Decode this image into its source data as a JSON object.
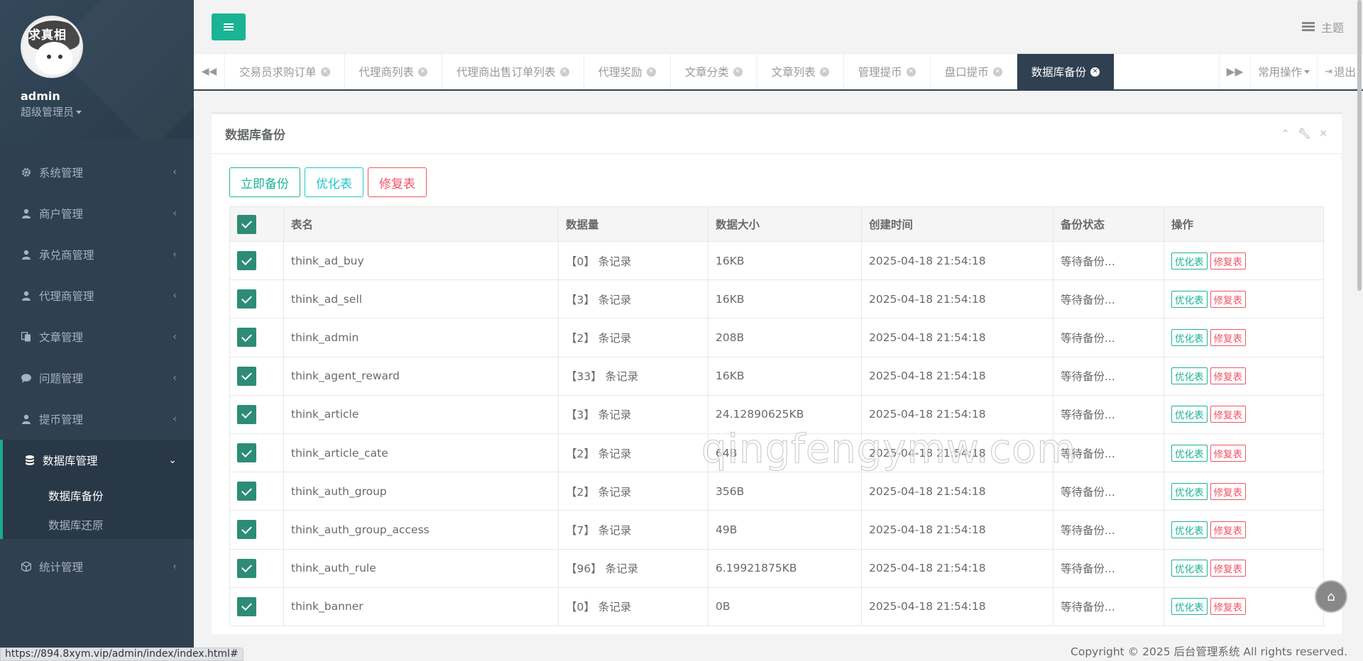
{
  "profile": {
    "logo_text": "求真相",
    "name": "admin",
    "role": "超级管理员"
  },
  "sidebar": {
    "items": [
      {
        "label": "系统管理",
        "icon": "gear-icon"
      },
      {
        "label": "商户管理",
        "icon": "user-icon"
      },
      {
        "label": "承兑商管理",
        "icon": "user-icon"
      },
      {
        "label": "代理商管理",
        "icon": "user-icon"
      },
      {
        "label": "文章管理",
        "icon": "copy-icon"
      },
      {
        "label": "问题管理",
        "icon": "comment-icon"
      },
      {
        "label": "提币管理",
        "icon": "user-icon"
      }
    ],
    "active_group": {
      "label": "数据库管理",
      "icon": "database-icon",
      "sub_items": [
        "数据库备份",
        "数据库还原"
      ]
    },
    "last_item": {
      "label": "统计管理",
      "icon": "cube-icon"
    }
  },
  "topbar": {
    "theme_label": "主题"
  },
  "tabs": {
    "items": [
      "交易员求购订单",
      "代理商列表",
      "代理商出售订单列表",
      "代理奖励",
      "文章分类",
      "文章列表",
      "管理提币",
      "盘口提币",
      "数据库备份"
    ],
    "active_index": 8,
    "common_ops": "常用操作",
    "logout": "退出"
  },
  "panel": {
    "title": "数据库备份",
    "buttons": {
      "backup": "立即备份",
      "optimize": "优化表",
      "repair": "修复表"
    }
  },
  "table": {
    "headers": [
      "表名",
      "数据量",
      "数据大小",
      "创建时间",
      "备份状态",
      "操作"
    ],
    "action_optimize": "优化表",
    "action_repair": "修复表",
    "rows": [
      {
        "name": "think_ad_buy",
        "count": "【0】 条记录",
        "size": "16KB",
        "time": "2025-04-18 21:54:18",
        "status": "等待备份..."
      },
      {
        "name": "think_ad_sell",
        "count": "【3】 条记录",
        "size": "16KB",
        "time": "2025-04-18 21:54:18",
        "status": "等待备份..."
      },
      {
        "name": "think_admin",
        "count": "【2】 条记录",
        "size": "208B",
        "time": "2025-04-18 21:54:18",
        "status": "等待备份..."
      },
      {
        "name": "think_agent_reward",
        "count": "【33】 条记录",
        "size": "16KB",
        "time": "2025-04-18 21:54:18",
        "status": "等待备份..."
      },
      {
        "name": "think_article",
        "count": "【3】 条记录",
        "size": "24.12890625KB",
        "time": "2025-04-18 21:54:18",
        "status": "等待备份..."
      },
      {
        "name": "think_article_cate",
        "count": "【2】 条记录",
        "size": "64B",
        "time": "2025-04-18 21:54:18",
        "status": "等待备份..."
      },
      {
        "name": "think_auth_group",
        "count": "【2】 条记录",
        "size": "356B",
        "time": "2025-04-18 21:54:18",
        "status": "等待备份..."
      },
      {
        "name": "think_auth_group_access",
        "count": "【7】 条记录",
        "size": "49B",
        "time": "2025-04-18 21:54:18",
        "status": "等待备份..."
      },
      {
        "name": "think_auth_rule",
        "count": "【96】 条记录",
        "size": "6.19921875KB",
        "time": "2025-04-18 21:54:18",
        "status": "等待备份..."
      },
      {
        "name": "think_banner",
        "count": "【0】 条记录",
        "size": "0B",
        "time": "2025-04-18 21:54:18",
        "status": "等待备份..."
      }
    ]
  },
  "watermark": "qingfengymw.com",
  "footer": "Copyright © 2025 后台管理系统 All rights reserved.",
  "status_url": "https://894.8xym.vip/admin/index/index.html#",
  "colors": {
    "accent": "#1ab394",
    "sidebar": "#2f4050",
    "danger": "#ed5565",
    "info": "#23c6c8"
  }
}
